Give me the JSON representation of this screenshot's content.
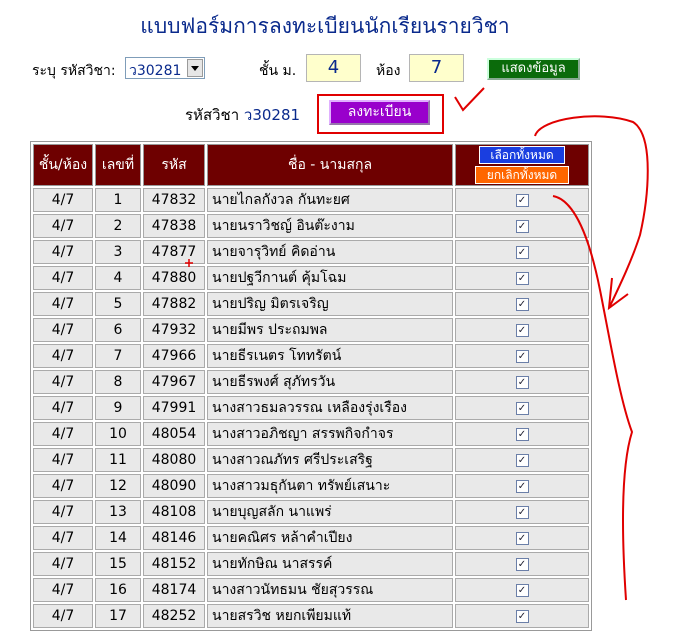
{
  "title": "แบบฟอร์มการลงทะเบียนนักเรียนรายวิชา",
  "controls": {
    "subject_label": "ระบุ รหัสวิชา:",
    "subject_value": "ว30281",
    "grade_label": "ชั้น ม.",
    "grade_value": "4",
    "room_label": "ห้อง",
    "room_value": "7",
    "show_button": "แสดงข้อมูล"
  },
  "register": {
    "label": "รหัสวิชา",
    "code": "ว30281",
    "button": "ลงทะเบียน"
  },
  "table": {
    "headers": [
      "ชั้น/ห้อง",
      "เลขที่",
      "รหัส",
      "ชื่อ - นามสกุล"
    ],
    "select_all": "เลือกทั้งหมด",
    "unselect_all": "ยกเลิกทั้งหมด",
    "rows": [
      {
        "class": "4/7",
        "no": "1",
        "id": "47832",
        "name": "นายไกลกังวล กันทะยศ",
        "checked": true
      },
      {
        "class": "4/7",
        "no": "2",
        "id": "47838",
        "name": "นายนราวิชญ์ อินต๊ะงาม",
        "checked": true
      },
      {
        "class": "4/7",
        "no": "3",
        "id": "47877",
        "name": "นายจารุวิทย์ คิดอ่าน",
        "checked": true
      },
      {
        "class": "4/7",
        "no": "4",
        "id": "47880",
        "name": "นายปฐวีกานต์ คุ้มโฉม",
        "checked": true
      },
      {
        "class": "4/7",
        "no": "5",
        "id": "47882",
        "name": "นายปริญ มิตรเจริญ",
        "checked": true
      },
      {
        "class": "4/7",
        "no": "6",
        "id": "47932",
        "name": "นายมีพร ประถมพล",
        "checked": true
      },
      {
        "class": "4/7",
        "no": "7",
        "id": "47966",
        "name": "นายธีรเนตร โททรัตน์",
        "checked": true
      },
      {
        "class": "4/7",
        "no": "8",
        "id": "47967",
        "name": "นายธีรพงศ์ สุภัทรวัน",
        "checked": true
      },
      {
        "class": "4/7",
        "no": "9",
        "id": "47991",
        "name": "นางสาวธมลวรรณ เหลืองรุ่งเรือง",
        "checked": true
      },
      {
        "class": "4/7",
        "no": "10",
        "id": "48054",
        "name": "นางสาวอภิชญา สรรพกิจกำจร",
        "checked": true
      },
      {
        "class": "4/7",
        "no": "11",
        "id": "48080",
        "name": "นางสาวณภัทร ศรีประเสริฐ",
        "checked": true
      },
      {
        "class": "4/7",
        "no": "12",
        "id": "48090",
        "name": "นางสาวมธุกันตา ทรัพย์เสนาะ",
        "checked": true
      },
      {
        "class": "4/7",
        "no": "13",
        "id": "48108",
        "name": "นายบุญสลัก นาแพร่",
        "checked": true
      },
      {
        "class": "4/7",
        "no": "14",
        "id": "48146",
        "name": "นายคณิศร หล้าคำเปียง",
        "checked": true
      },
      {
        "class": "4/7",
        "no": "15",
        "id": "48152",
        "name": "นายทักษิณ นาสรรค์",
        "checked": true
      },
      {
        "class": "4/7",
        "no": "16",
        "id": "48174",
        "name": "นางสาวนัทธมน ชัยสุวรรณ",
        "checked": true
      },
      {
        "class": "4/7",
        "no": "17",
        "id": "48252",
        "name": "นายสรวิช หยกเพียมแท้",
        "checked": true
      }
    ]
  },
  "colors": {
    "header_bg": "#6e0000",
    "title": "#0a2a8c",
    "register_button": "#9900cc",
    "show_button": "#0b6b0b",
    "annotation": "#e00000"
  }
}
